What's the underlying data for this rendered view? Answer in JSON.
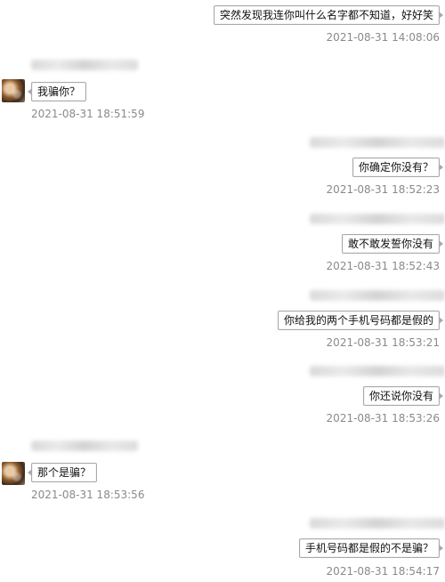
{
  "messages": [
    {
      "side": "right",
      "text": "突然发现我连你叫什么名字都不知道，好好笑",
      "time": "2021-08-31 14:08:06",
      "name_blurred": false
    },
    {
      "side": "left",
      "text": "我骗你？",
      "time": "2021-08-31 18:51:59",
      "name_blurred": true
    },
    {
      "side": "right",
      "text": "你确定你没有？",
      "time": "2021-08-31 18:52:23",
      "name_blurred": true
    },
    {
      "side": "right",
      "text": "敢不敢发誓你没有",
      "time": "2021-08-31 18:52:43",
      "name_blurred": true
    },
    {
      "side": "right",
      "text": "你给我的两个手机号码都是假的",
      "time": "2021-08-31 18:53:21",
      "name_blurred": true
    },
    {
      "side": "right",
      "text": "你还说你没有",
      "time": "2021-08-31 18:53:26",
      "name_blurred": true
    },
    {
      "side": "left",
      "text": "那个是骗？",
      "time": "2021-08-31 18:53:56",
      "name_blurred": true
    },
    {
      "side": "right",
      "text": "手机号码都是假的不是骗？",
      "time": "2021-08-31 18:54:17",
      "name_blurred": true
    }
  ]
}
